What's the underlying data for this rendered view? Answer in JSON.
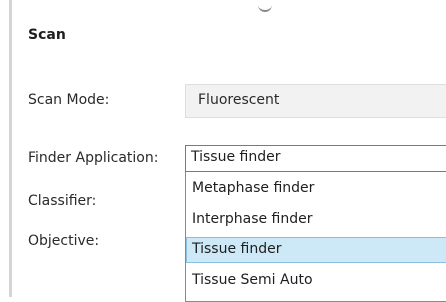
{
  "section": {
    "title": "Scan"
  },
  "form": {
    "scan_mode": {
      "label": "Scan Mode:",
      "value": "Fluorescent"
    },
    "finder_application": {
      "label": "Finder Application:",
      "value": "Tissue finder"
    },
    "classifier": {
      "label": "Classifier:"
    },
    "objective": {
      "label": "Objective:"
    }
  },
  "dropdown": {
    "options": [
      {
        "label": "Metaphase finder",
        "selected": false
      },
      {
        "label": "Interphase finder",
        "selected": false
      },
      {
        "label": "Tissue finder",
        "selected": true
      },
      {
        "label": "Tissue Semi Auto",
        "selected": false
      }
    ]
  },
  "colors": {
    "selected_background": "#cde8f6",
    "selected_border": "#8cc0dc"
  }
}
